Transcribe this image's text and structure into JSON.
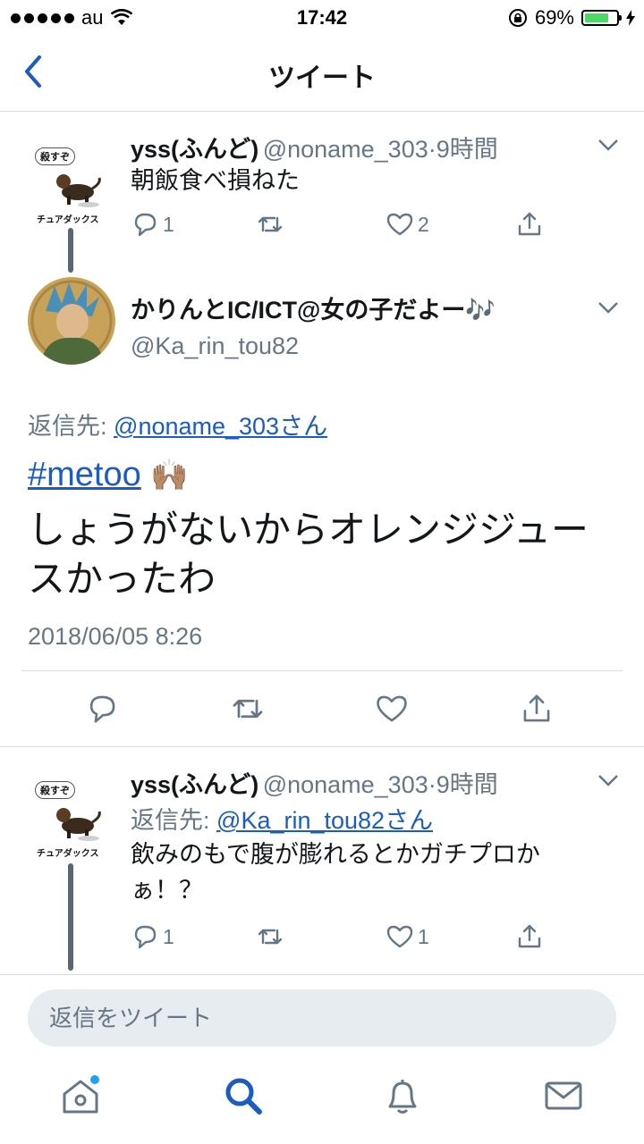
{
  "status_bar": {
    "carrier": "au",
    "time": "17:42",
    "battery": "69%",
    "battery_level": 0.69
  },
  "nav": {
    "title": "ツイート"
  },
  "tweet1": {
    "name": "yss(ふんど)",
    "handle": "@noname_303",
    "sep": "·",
    "time": "9時間",
    "text": "朝飯食べ損ねた",
    "reply_count": "1",
    "like_count": "2",
    "avatar_caption_top": "殺すぞ",
    "avatar_caption_bottom": "チュアダックス"
  },
  "main_tweet": {
    "name": "かりんとIC/ICT@女の子だよー🎶",
    "handle": "@Ka_rin_tou82",
    "reply_to_label": "返信先:",
    "reply_to_user": "@noname_303さん",
    "hashtag": "#metoo",
    "emoji": "🙌🏽",
    "text": "しょうがないからオレンジジュースかったわ",
    "timestamp": "2018/06/05 8:26"
  },
  "tweet3": {
    "name": "yss(ふんど)",
    "handle": "@noname_303",
    "sep": "·",
    "time": "9時間",
    "reply_to_label": "返信先:",
    "reply_to_user": "@Ka_rin_tou82さん",
    "text": "飲みのもで腹が膨れるとかガチプロかぁ！？",
    "reply_count": "1",
    "like_count": "1",
    "avatar_caption_top": "殺すぞ",
    "avatar_caption_bottom": "チュアダックス"
  },
  "reply_bar": {
    "placeholder": "返信をツイート"
  },
  "colors": {
    "link": "#1c5cc2",
    "muted": "#657786",
    "accent": "#1da1f2",
    "battery": "#4cd964"
  }
}
